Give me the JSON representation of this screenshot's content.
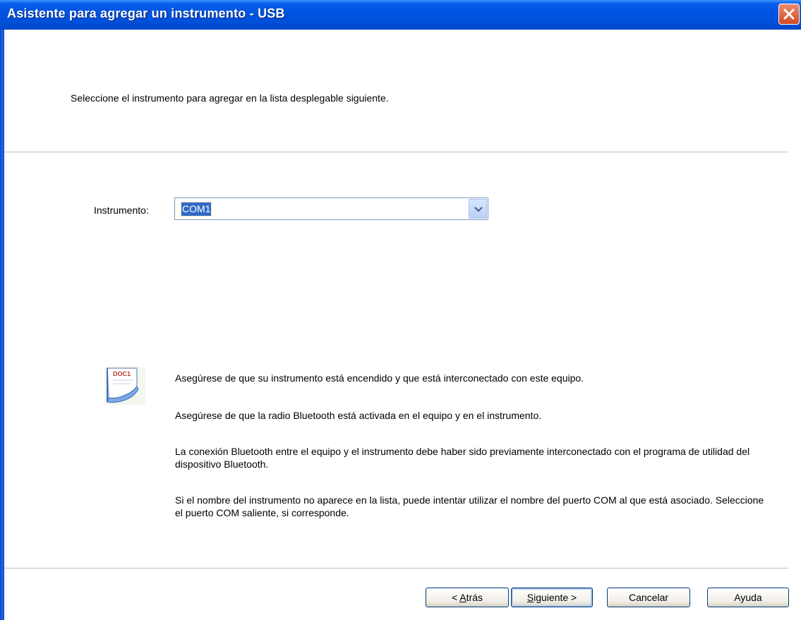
{
  "window": {
    "title": "Asistente para agregar un instrumento - USB"
  },
  "instruction": "Seleccione el instrumento para agregar en la lista desplegable siguiente.",
  "instrument_field": {
    "label": "Instrumento:",
    "value": "COM1"
  },
  "icon": {
    "name": "doc-icon",
    "text": "DOC1"
  },
  "info_paragraphs": [
    "Asegúrese de que su instrumento está encendido y que está interconectado con este equipo.",
    "Asegúrese de que la radio Bluetooth está activada en el equipo y en el instrumento.",
    "La conexión Bluetooth entre el equipo y el instrumento debe haber sido previamente interconectado con el programa de utilidad del dispositivo Bluetooth.",
    "Si el nombre del instrumento no aparece en la lista, puede intentar utilizar el nombre del puerto COM al que está asociado. Seleccione el puerto COM saliente, si corresponde."
  ],
  "buttons": {
    "back": {
      "prefix": "< ",
      "accel": "A",
      "rest": "trás"
    },
    "next": {
      "accel": "S",
      "rest": "iguiente >"
    },
    "cancel": {
      "label": "Cancelar"
    },
    "help": {
      "label": "Ayuda"
    }
  },
  "colors": {
    "title_bar": "#0054E3",
    "selection": "#316AC5",
    "close_button": "#D34A23"
  }
}
